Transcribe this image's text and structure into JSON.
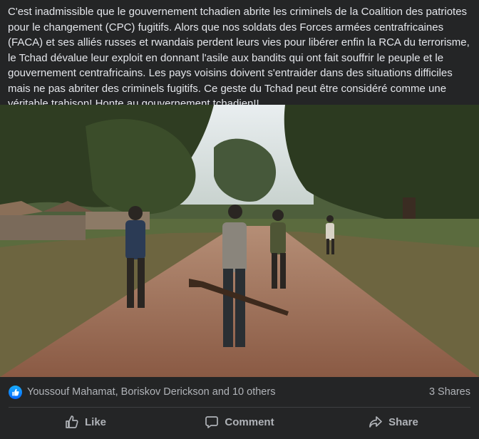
{
  "post": {
    "text": "C'est inadmissible que le gouvernement tchadien abrite les criminels de la Coalition des patriotes pour le changement (CPC) fugitifs. Alors que nos soldats des Forces armées centrafricaines (FACA) et ses alliés russes et rwandais perdent leurs vies pour libérer enfin la RCA du terrorisme, le Tchad dévalue leur exploit en donnant l'asile aux bandits qui ont fait souffrir le peuple et le gouvernement centrafricains. Les pays voisins doivent s'entraider dans des situations difficiles mais ne pas abriter des criminels fugitifs. Ce geste du Tchad peut être considéré comme une véritable trahison! Honte au gouvernement tchadien!!"
  },
  "reactions": {
    "icon": "like-icon",
    "names": "Youssouf Mahamat, Boriskov Derickson and 10 others",
    "shares": "3 Shares"
  },
  "actions": {
    "like": {
      "label": "Like",
      "icon": "thumbs-up-icon"
    },
    "comment": {
      "label": "Comment",
      "icon": "comment-icon"
    },
    "share": {
      "label": "Share",
      "icon": "share-icon"
    }
  },
  "colors": {
    "background": "#242526",
    "text": "#e4e6eb",
    "secondary_text": "#b0b3b8",
    "like_blue": "#0866ff"
  }
}
